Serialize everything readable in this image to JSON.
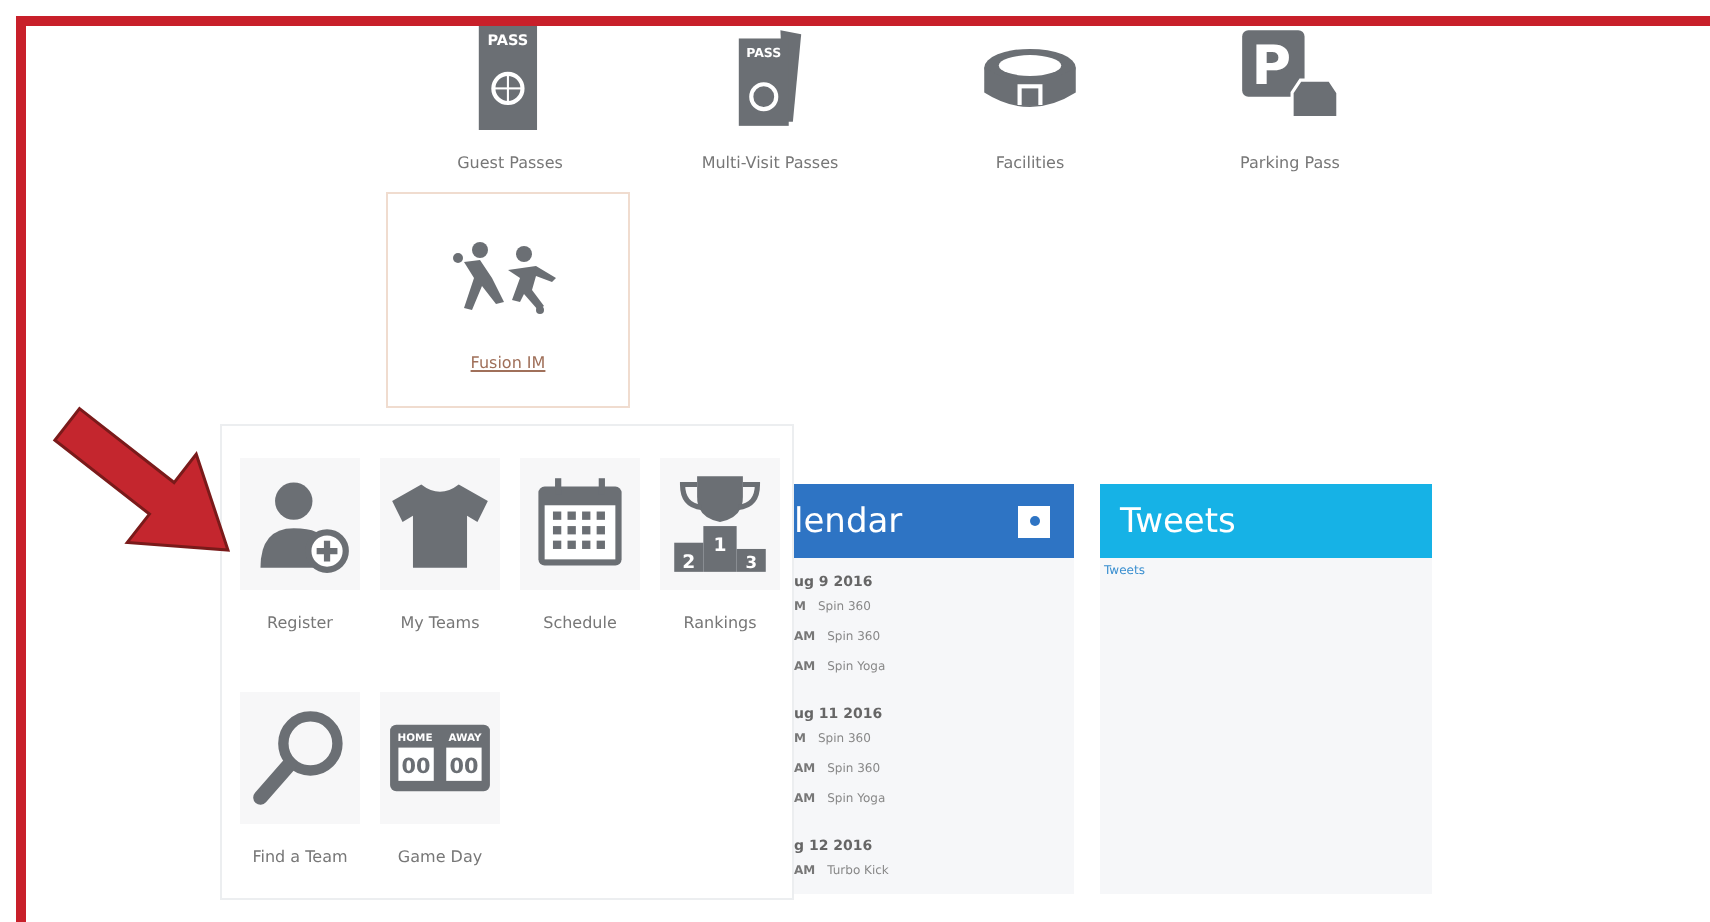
{
  "top_tiles": [
    {
      "label": "Guest Passes",
      "kind": "pass",
      "icon_text": [
        "PASS"
      ]
    },
    {
      "label": "Multi-Visit Passes",
      "kind": "passes",
      "icon_text": [
        "PASS"
      ]
    },
    {
      "label": "Facilities",
      "kind": "stadium"
    },
    {
      "label": "Parking Pass",
      "kind": "parking",
      "icon_text": [
        "P"
      ]
    }
  ],
  "featured_tile": {
    "label": "Fusion IM"
  },
  "menu": {
    "items": [
      {
        "label": "Register",
        "kind": "register"
      },
      {
        "label": "My Teams",
        "kind": "shirt"
      },
      {
        "label": "Schedule",
        "kind": "calendar"
      },
      {
        "label": "Rankings",
        "kind": "trophy",
        "icon_text": [
          "1",
          "2",
          "3"
        ]
      },
      {
        "label": "Find a Team",
        "kind": "search"
      },
      {
        "label": "Game Day",
        "kind": "scoreboard",
        "icon_text": [
          "HOME",
          "AWAY",
          "00",
          "00"
        ]
      }
    ]
  },
  "calendar": {
    "title": "lendar",
    "days": [
      {
        "date": "ug 9 2016",
        "events": [
          {
            "time": "M",
            "name": "Spin 360"
          },
          {
            "time": "AM",
            "name": "Spin 360"
          },
          {
            "time": "AM",
            "name": "Spin Yoga"
          }
        ]
      },
      {
        "date": "ug 11 2016",
        "events": [
          {
            "time": "M",
            "name": "Spin 360"
          },
          {
            "time": "AM",
            "name": "Spin 360"
          },
          {
            "time": "AM",
            "name": "Spin Yoga"
          }
        ]
      },
      {
        "date": "g 12 2016",
        "events": [
          {
            "time": "AM",
            "name": "Turbo Kick"
          }
        ]
      }
    ]
  },
  "tweets": {
    "title": "Tweets",
    "link": "Tweets"
  }
}
